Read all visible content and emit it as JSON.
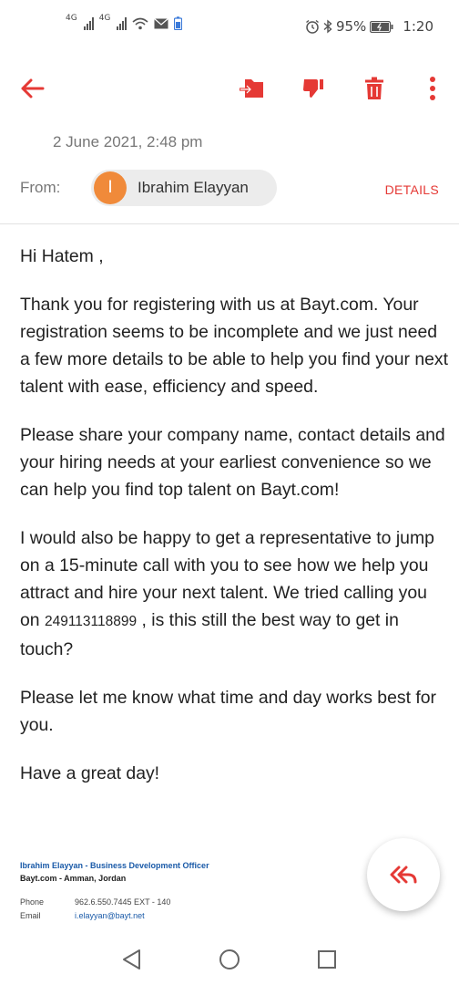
{
  "status_bar": {
    "network1": "4G",
    "network2": "4G",
    "battery_percent": "95%",
    "time": "1:20"
  },
  "toolbar": {
    "back_icon": "arrow-left-icon",
    "move_icon": "move-to-folder-icon",
    "dislike_icon": "thumb-down-icon",
    "delete_icon": "trash-icon",
    "more_icon": "more-vertical-icon"
  },
  "email": {
    "date": "2 June 2021, 2:48 pm",
    "from_label": "From:",
    "sender_initial": "I",
    "sender_name": "Ibrahim Elayyan",
    "details_label": "DETAILS",
    "greeting": "Hi Hatem ,",
    "para1": "Thank you for registering with us at Bayt.com. Your registration seems to be incomplete and we just need a few more details to be able to help you find your next talent with ease, efficiency and speed.",
    "para2": "Please share your company name, contact details and your hiring needs at your earliest convenience so we can help you find top talent on Bayt.com!",
    "para3_start": "I would also be happy to get a representative to jump on a 15-minute call with you to see how we help you attract and hire your next talent. We tried calling you on ",
    "phone_number": "249113118899",
    "para3_end": " , is this still the best way to get in touch?",
    "para4": "Please let me know what time and day works best for you.",
    "closing": "Have a great day!"
  },
  "signature": {
    "name_title": "Ibrahim Elayyan - Business Development Officer",
    "company": "Bayt.com - Amman, Jordan",
    "phone_label": "Phone",
    "phone_value": "962.6.550.7445 EXT - 140",
    "email_label": "Email",
    "email_value": "i.elayyan@bayt.net"
  },
  "fab": {
    "icon": "reply-all-icon"
  },
  "nav_bar": {
    "back_icon": "triangle-back-icon",
    "home_icon": "circle-home-icon",
    "recents_icon": "square-recents-icon"
  },
  "colors": {
    "accent": "#e53935",
    "avatar": "#f08a3a",
    "link_blue": "#1a5aa8"
  }
}
